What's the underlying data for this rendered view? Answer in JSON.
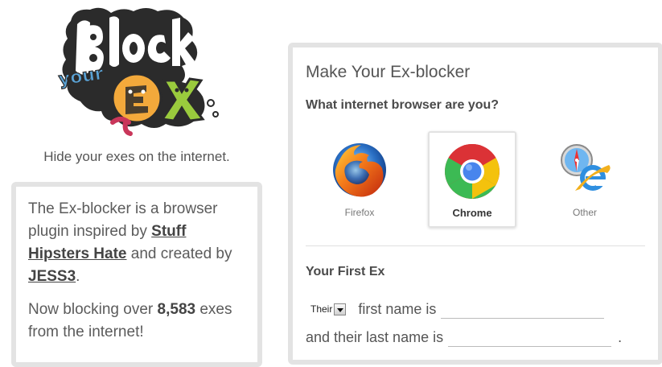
{
  "logo": {
    "line1": "Block",
    "line2": "your",
    "line3": "EX",
    "colors": {
      "outline": "#2b2b2b",
      "letters": "#ffffff",
      "your": "#5aa3d6",
      "ex_e": "#f3a93b",
      "ex_x": "#9acb3d",
      "worm": "#c9365a"
    }
  },
  "tagline": "Hide your exes on the internet.",
  "info": {
    "p1_before": "The Ex-blocker is a browser plugin inspired by ",
    "link_stuff": "Stuff Hipsters Hate",
    "p1_middle": " and created by ",
    "link_jess": "JESS3",
    "p1_end": ".",
    "p2_before": "Now blocking over ",
    "count": "8,583",
    "p2_after": " exes from the internet!"
  },
  "form": {
    "title": "Make Your Ex-blocker",
    "browser_question": "What internet browser are you?",
    "browsers": [
      {
        "label": "Firefox",
        "icon": "firefox-icon",
        "selected": false
      },
      {
        "label": "Chrome",
        "icon": "chrome-icon",
        "selected": true
      },
      {
        "label": "Other",
        "icon": "safari-ie-icon",
        "selected": false
      }
    ],
    "section_heading": "Your First Ex",
    "pronoun_value": "Their",
    "first_name_text": "first name is",
    "first_name_value": "",
    "last_name_text": "and their last name is",
    "last_name_value": "",
    "trailing": "."
  }
}
